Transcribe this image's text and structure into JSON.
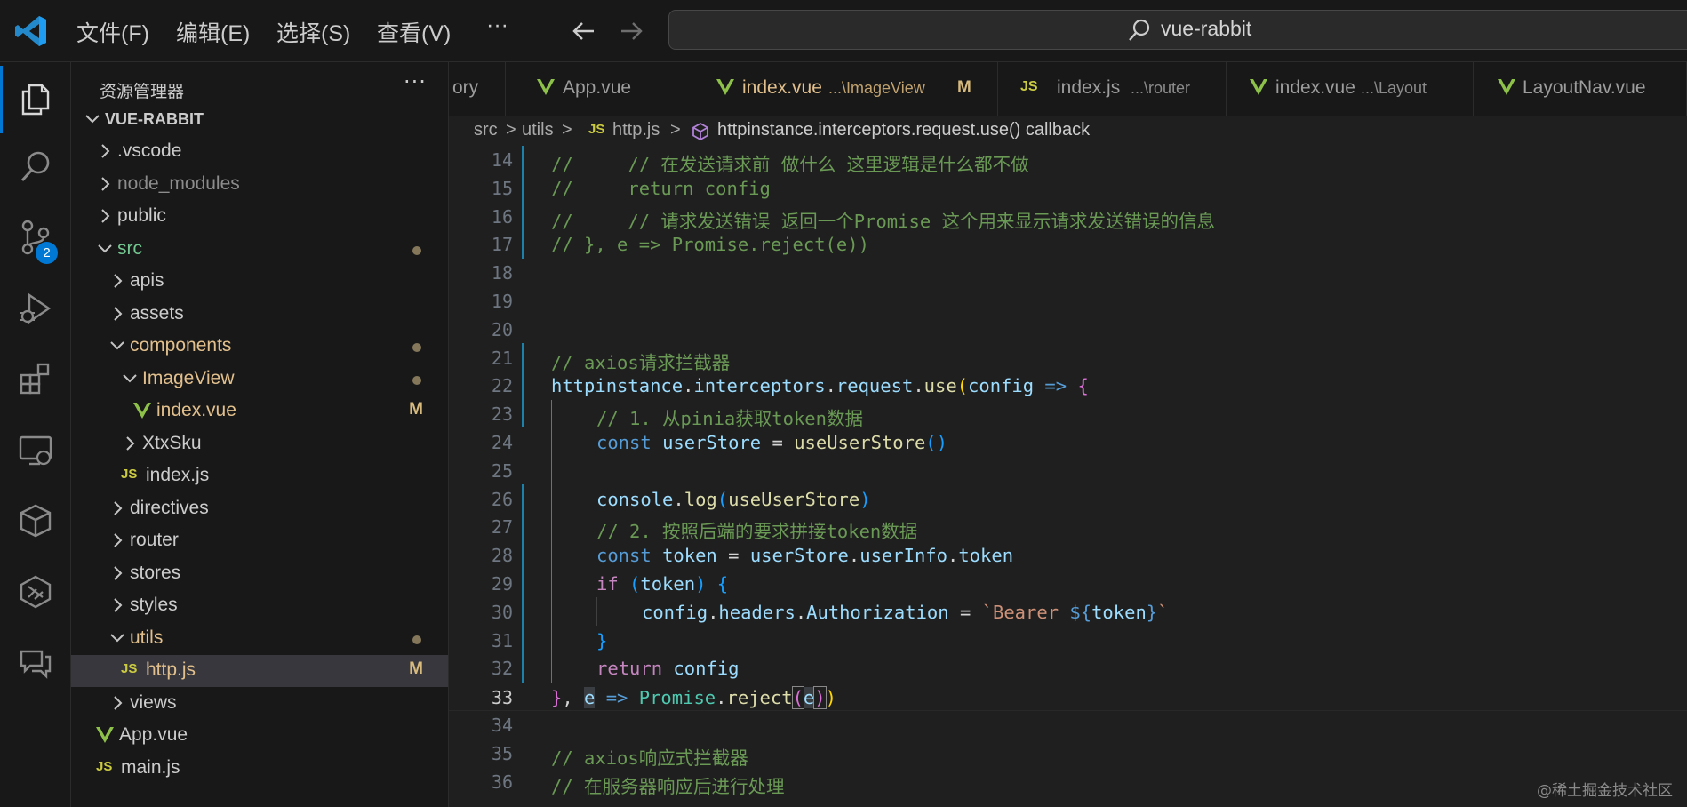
{
  "titlebar": {
    "menu": [
      "文件(F)",
      "编辑(E)",
      "选择(S)",
      "查看(V)",
      "···"
    ],
    "back_icon": "arrow-left-icon",
    "forward_icon": "arrow-right-icon",
    "search_text": "vue-rabbit"
  },
  "activity": {
    "icons": [
      "explorer-icon",
      "search-icon",
      "source-control-icon",
      "run-debug-icon",
      "extensions-icon",
      "remote-explorer-icon",
      "box-icon",
      "mcp-icon",
      "chat-icon"
    ],
    "scm_badge": "2"
  },
  "sidebar": {
    "title": "资源管理器",
    "more": "···",
    "root": "VUE-RABBIT",
    "items": [
      {
        "label": "VUE-RABBIT"
      },
      {
        "label": ".vscode"
      },
      {
        "label": "node_modules"
      },
      {
        "label": "public"
      },
      {
        "label": "src"
      },
      {
        "label": "apis"
      },
      {
        "label": "assets"
      },
      {
        "label": "components"
      },
      {
        "label": "ImageView"
      },
      {
        "label": "index.vue",
        "flag": "M"
      },
      {
        "label": "XtxSku"
      },
      {
        "label": "index.js"
      },
      {
        "label": "directives"
      },
      {
        "label": "router"
      },
      {
        "label": "stores"
      },
      {
        "label": "styles"
      },
      {
        "label": "utils"
      },
      {
        "label": "http.js",
        "flag": "M"
      },
      {
        "label": "views"
      },
      {
        "label": "App.vue"
      },
      {
        "label": "main.js"
      }
    ],
    "js_badge": "JS"
  },
  "tabs": [
    {
      "label": "ory",
      "desc": ""
    },
    {
      "label": "App.vue",
      "desc": ""
    },
    {
      "label": "index.vue",
      "desc": "...\\ImageView",
      "flag": "M"
    },
    {
      "label": "index.js",
      "desc": "...\\router"
    },
    {
      "label": "index.vue",
      "desc": "...\\Layout"
    },
    {
      "label": "LayoutNav.vue",
      "desc": ""
    }
  ],
  "breadcrumb": {
    "parts": [
      "src",
      "utils",
      "http.js",
      "httpinstance.interceptors.request.use() callback"
    ],
    "sep": ">",
    "js": "JS"
  },
  "editor": {
    "line_numbers": [
      "14",
      "15",
      "16",
      "17",
      "18",
      "19",
      "20",
      "21",
      "22",
      "23",
      "24",
      "25",
      "26",
      "27",
      "28",
      "29",
      "30",
      "31",
      "32",
      "33",
      "34",
      "35",
      "36"
    ],
    "current_line": "33"
  },
  "code": {
    "l14": "//     // 在发送请求前 做什么 这里逻辑是什么都不做",
    "l15": "//     return config",
    "l16": "//     // 请求发送错误 返回一个Promise 这个用来显示请求发送错误的信息",
    "l17": "// }, e => Promise.reject(e))",
    "l21": "// axios请求拦截器",
    "t_httpinstance": "httpinstance",
    "t_dot": ".",
    "t_interceptors": "interceptors",
    "t_request": "request",
    "t_use": "use",
    "t_lparen": "(",
    "t_rparen": ")",
    "t_config": "config",
    "t_arrow": " => ",
    "t_lbrace": "{",
    "t_rbrace": "}",
    "l23": "// 1. 从pinia获取token数据",
    "t_const": "const",
    "t_userStore": "userStore",
    "t_eq": " = ",
    "t_useUserStore": "useUserStore",
    "t_console": "console",
    "t_log": "log",
    "l27": "// 2. 按照后端的要求拼接token数据",
    "t_token": "token",
    "t_userInfo": "userInfo",
    "t_if": "if",
    "t_headers": "headers",
    "t_Authorization": "Authorization",
    "t_tmpl_start": "`Bearer ",
    "t_tmpl_open": "${",
    "t_tmpl_close": "}",
    "t_tmpl_end": "`",
    "t_return": "return",
    "t_comma": ", ",
    "t_e": "e",
    "t_Promise": "Promise",
    "t_reject": "reject",
    "l35": "// axios响应式拦截器",
    "l36": "// 在服务器响应后进行处理"
  },
  "watermark": "@稀土掘金技术社区"
}
